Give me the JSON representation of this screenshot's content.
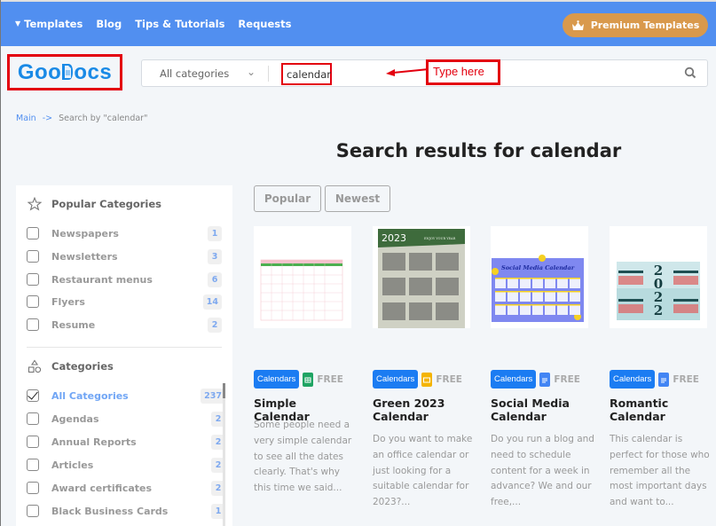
{
  "topnav": {
    "items": [
      {
        "label": "Templates",
        "has_caret": true
      },
      {
        "label": "Blog"
      },
      {
        "label": "Tips & Tutorials"
      },
      {
        "label": "Requests"
      }
    ],
    "premium_label": "Premium Templates"
  },
  "logo": {
    "prefix": "Goo",
    "suffix": "ocs"
  },
  "search": {
    "category_selected": "All categories",
    "query": "calendar",
    "annotation": "Type here"
  },
  "breadcrumb": {
    "home": "Main",
    "arrow": "->",
    "current": "Search by \"calendar\""
  },
  "page_title": "Search results for calendar",
  "sidebar": {
    "popular_heading": "Popular Categories",
    "popular": [
      {
        "label": "Newspapers",
        "count": "1"
      },
      {
        "label": "Newsletters",
        "count": "3"
      },
      {
        "label": "Restaurant menus",
        "count": "6"
      },
      {
        "label": "Flyers",
        "count": "14"
      },
      {
        "label": "Resume",
        "count": "2"
      }
    ],
    "categories_heading": "Categories",
    "categories": [
      {
        "label": "All Categories",
        "count": "237",
        "checked": true
      },
      {
        "label": "Agendas",
        "count": "2"
      },
      {
        "label": "Annual Reports",
        "count": "2"
      },
      {
        "label": "Articles",
        "count": "2"
      },
      {
        "label": "Award certificates",
        "count": "2"
      },
      {
        "label": "Black Business Cards",
        "count": "1"
      }
    ]
  },
  "sort": {
    "popular": "Popular",
    "newest": "Newest"
  },
  "cards": [
    {
      "tag": "Calendars",
      "app": "sheets",
      "free": "FREE",
      "title": "Simple Calendar",
      "desc": "Some people need a very simple calendar to see all the dates clearly. That's why this time we said..."
    },
    {
      "tag": "Calendars",
      "app": "slides",
      "free": "FREE",
      "title": "Green 2023 Calendar",
      "desc": "Do you want to make an office calendar or just looking for a suitable calendar for 2023?..."
    },
    {
      "tag": "Calendars",
      "app": "docs",
      "free": "FREE",
      "title": "Social Media Calendar",
      "desc": "Do you run a blog and need to schedule content for a week in advance? We and our free,..."
    },
    {
      "tag": "Calendars",
      "app": "docs",
      "free": "FREE",
      "title": "Romantic Calendar",
      "desc": "This calendar is perfect for those who remember all the most important days and want to..."
    }
  ],
  "thumbs": {
    "green_year": "2023",
    "green_tagline": "ENJOY YOUR YEAR",
    "social_title": "Social Media Calendar",
    "romantic_digits": [
      "2",
      "0",
      "2",
      "2"
    ]
  },
  "colors": {
    "nav": "#518ff0",
    "premium": "#d9994c",
    "tag": "#1b7cf2",
    "annotation": "#e3000f"
  }
}
